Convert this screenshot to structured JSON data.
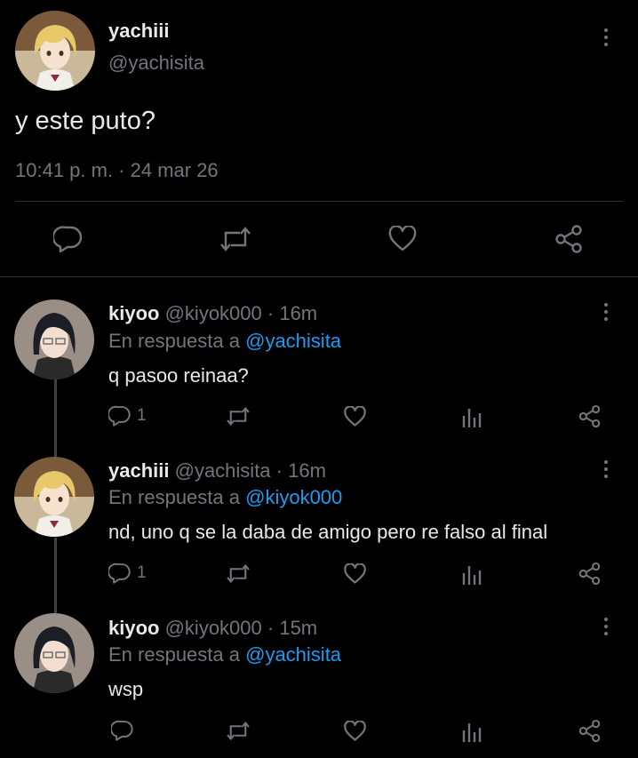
{
  "main_tweet": {
    "display_name": "yachiii",
    "handle": "@yachisita",
    "text": "y este puto?",
    "timestamp": "10:41 p. m. · 24 mar 26"
  },
  "replies": [
    {
      "display_name": "kiyoo",
      "handle": "@kiyok000",
      "time": "· 16m",
      "reply_prefix": "En respuesta a",
      "reply_to": "@yachisita",
      "text": "q pasoo reinaa?",
      "reply_count": "1"
    },
    {
      "display_name": "yachiii",
      "handle": "@yachisita",
      "time": "· 16m",
      "reply_prefix": "En respuesta a",
      "reply_to": "@kiyok000",
      "text": "nd, uno q se la daba de amigo pero re falso al final",
      "reply_count": "1"
    },
    {
      "display_name": "kiyoo",
      "handle": "@kiyok000",
      "time": "· 15m",
      "reply_prefix": "En respuesta a",
      "reply_to": "@yachisita",
      "text": "wsp",
      "reply_count": ""
    }
  ],
  "icons": {
    "reply": "reply-icon",
    "retweet": "retweet-icon",
    "like": "like-icon",
    "share": "share-icon",
    "analytics": "analytics-icon",
    "more": "more-icon"
  },
  "colors": {
    "background": "#000000",
    "text": "#e7e9ea",
    "muted": "#71767b",
    "link": "#1d9bf0",
    "divider": "#2f3336"
  }
}
